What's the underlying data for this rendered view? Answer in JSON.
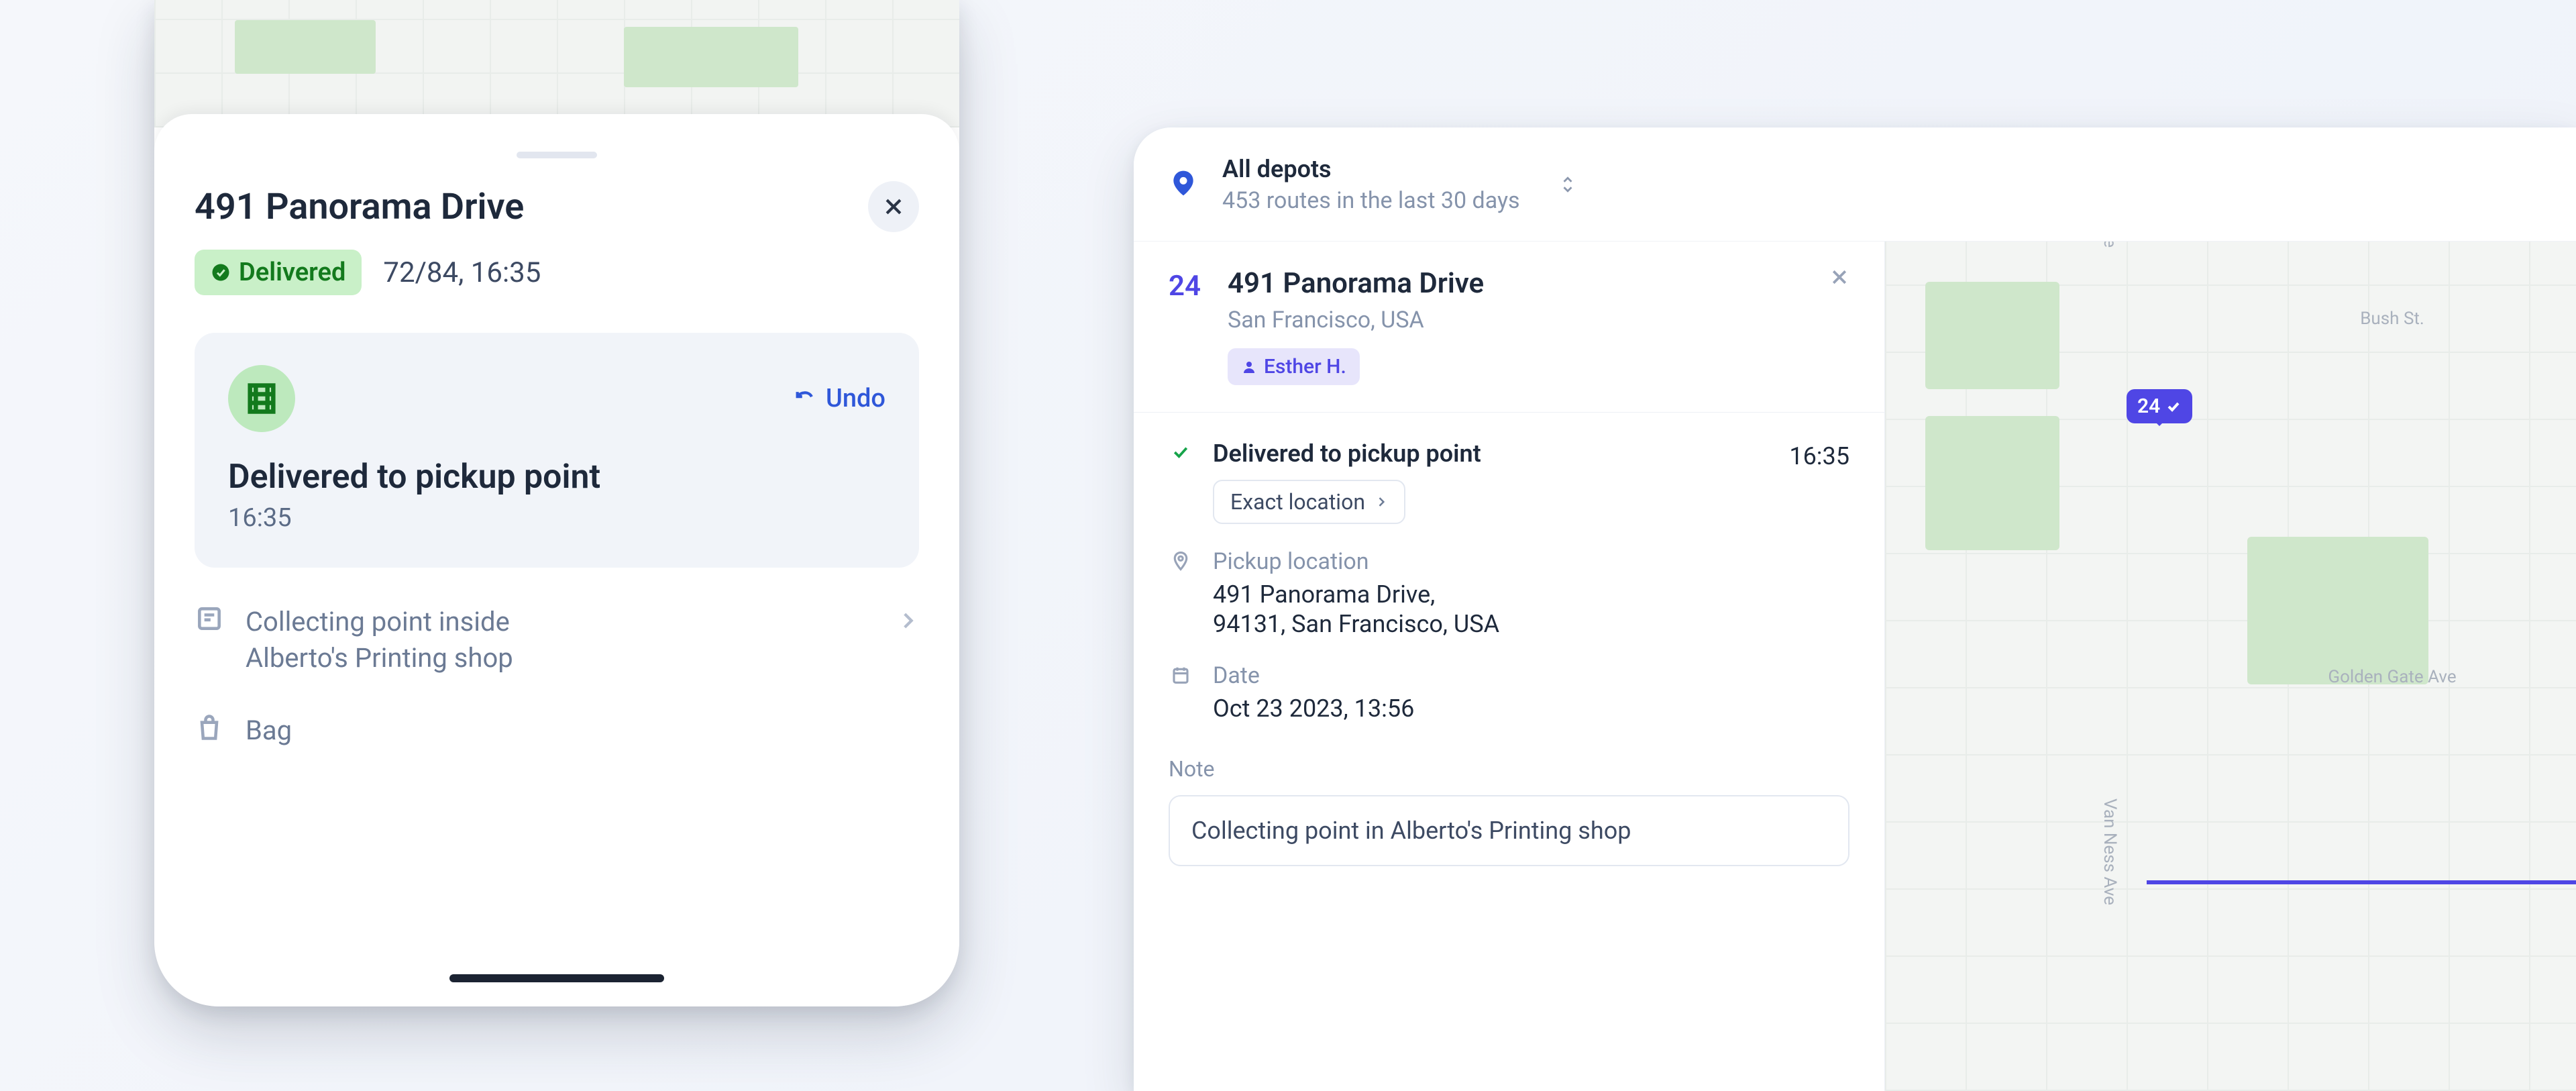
{
  "mobile": {
    "address_title": "491 Panorama Drive",
    "status_badge": "Delivered",
    "status_meta": "72/84, 16:35",
    "pickup_card": {
      "undo_label": "Undo",
      "title": "Delivered to pickup point",
      "time": "16:35"
    },
    "detail_note_line1": "Collecting point inside",
    "detail_note_line2": "Alberto's Printing shop",
    "detail_item": "Bag"
  },
  "desktop": {
    "topbar": {
      "title": "All depots",
      "subtitle": "453 routes in the last 30 days"
    },
    "stop": {
      "number": "24",
      "title": "491 Panorama Drive",
      "subtitle": "San Francisco, USA",
      "driver": "Esther H."
    },
    "delivery": {
      "status": "Delivered to pickup point",
      "time": "16:35",
      "exact_location_label": "Exact location"
    },
    "pickup_location": {
      "label": "Pickup location",
      "line1": "491 Panorama Drive,",
      "line2": "94131, San Francisco, USA"
    },
    "date": {
      "label": "Date",
      "value": "Oct 23 2023, 13:56"
    },
    "note": {
      "label": "Note",
      "value": "Collecting point in Alberto's Printing shop"
    },
    "map": {
      "marker_number": "24",
      "street_vanness": "Van Ness Ave",
      "street_bush": "Bush St.",
      "street_goldengate": "Golden Gate Ave"
    }
  }
}
